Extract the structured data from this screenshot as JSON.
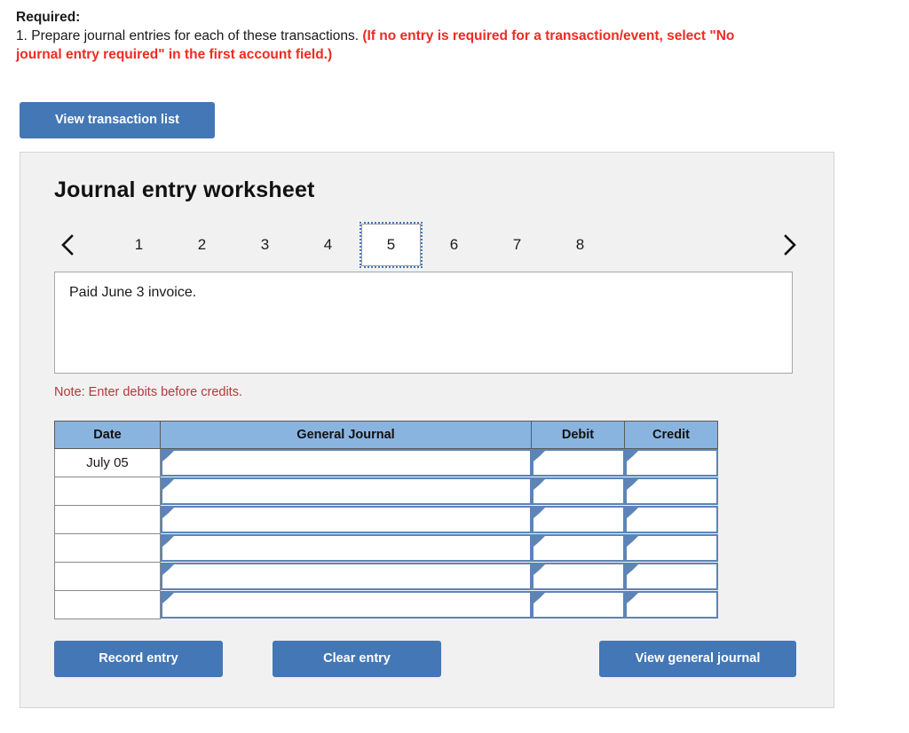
{
  "instructions": {
    "required_label": "Required:",
    "item_number": "1. Prepare journal entries for each of these transactions.",
    "red_part_line1": "(If no entry is required for a transaction/event, select \"No",
    "red_part_line2": "journal entry required\" in the first account field.)"
  },
  "toolbar": {
    "view_transaction_list_label": "View transaction list"
  },
  "worksheet": {
    "title": "Journal entry worksheet",
    "description": "Paid June 3 invoice.",
    "note": "Note: Enter debits before credits.",
    "pager": {
      "prev_icon": "chevron-left-icon",
      "next_icon": "chevron-right-icon",
      "pages": [
        "1",
        "2",
        "3",
        "4",
        "5",
        "6",
        "7",
        "8"
      ],
      "active_page": "5"
    },
    "table": {
      "headers": [
        "Date",
        "General Journal",
        "Debit",
        "Credit"
      ],
      "rows": [
        {
          "date": "July 05",
          "general_journal": "",
          "debit": "",
          "credit": ""
        },
        {
          "date": "",
          "general_journal": "",
          "debit": "",
          "credit": ""
        },
        {
          "date": "",
          "general_journal": "",
          "debit": "",
          "credit": ""
        },
        {
          "date": "",
          "general_journal": "",
          "debit": "",
          "credit": ""
        },
        {
          "date": "",
          "general_journal": "",
          "debit": "",
          "credit": ""
        },
        {
          "date": "",
          "general_journal": "",
          "debit": "",
          "credit": ""
        }
      ]
    },
    "actions": {
      "record_entry_label": "Record entry",
      "clear_entry_label": "Clear entry",
      "view_general_journal_label": "View general journal"
    }
  },
  "colors": {
    "button_blue": "#4477b5",
    "table_header_blue": "#8ab4e0",
    "input_border_blue": "#5c84b8",
    "alert_red": "#ee2b24",
    "note_red": "#b03a3a",
    "panel_bg": "#f1f1f1"
  }
}
